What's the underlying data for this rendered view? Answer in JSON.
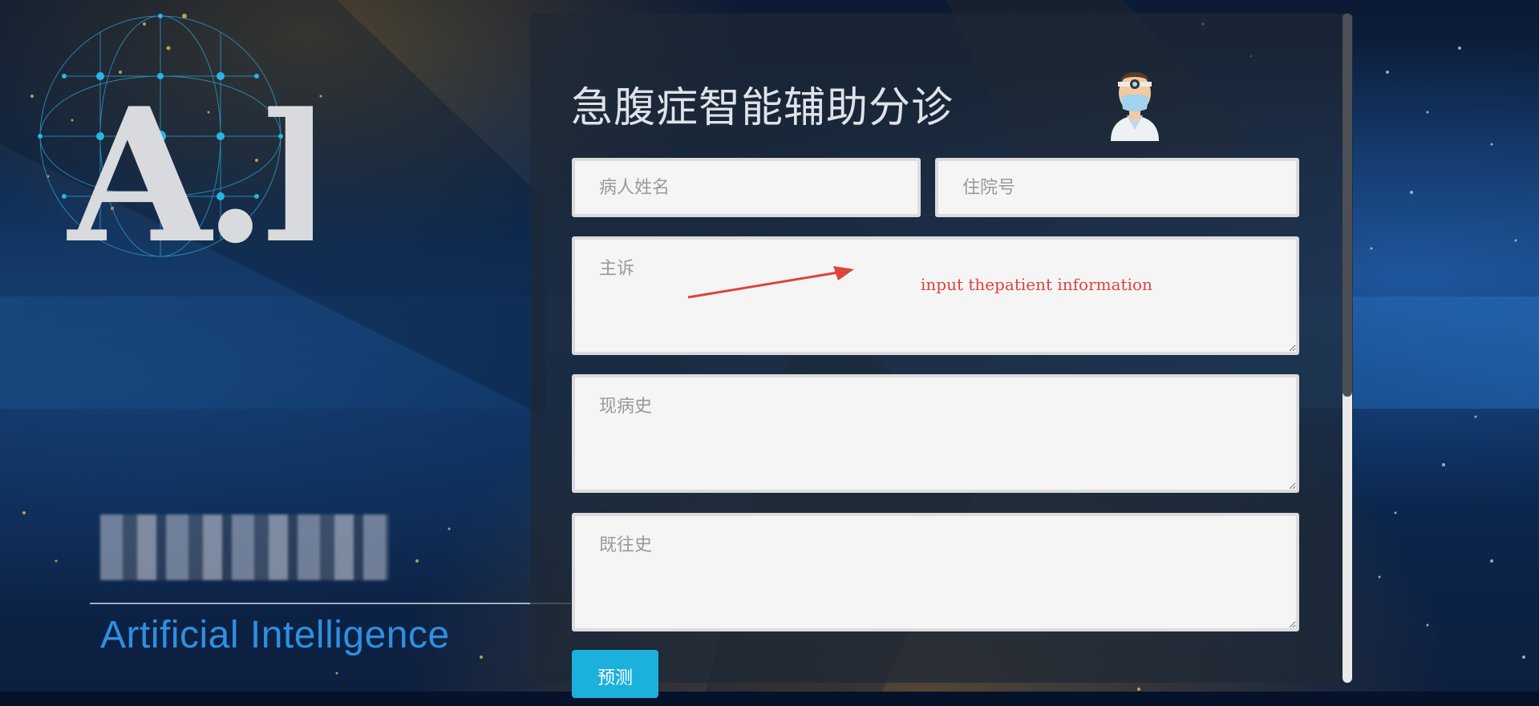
{
  "header": {
    "title": "急腹症智能辅助分诊"
  },
  "brand": {
    "logo_text": "A.I.",
    "subtitle": "Artificial  Intelligence"
  },
  "form": {
    "name_placeholder": "病人姓名",
    "admission_placeholder": "住院号",
    "chief_complaint_placeholder": "主诉",
    "present_history_placeholder": "现病史",
    "past_history_placeholder": "既往史",
    "predict_label": "预测"
  },
  "annotation": {
    "text": "input thepatient information",
    "color": "#e0433b"
  },
  "colors": {
    "button": "#1cb0dc",
    "brand_text": "#2f8fe0",
    "panel": "rgba(30,40,52,0.72)"
  },
  "icons": {
    "doctor": "doctor-avatar-icon",
    "globe": "ai-network-globe-icon"
  }
}
